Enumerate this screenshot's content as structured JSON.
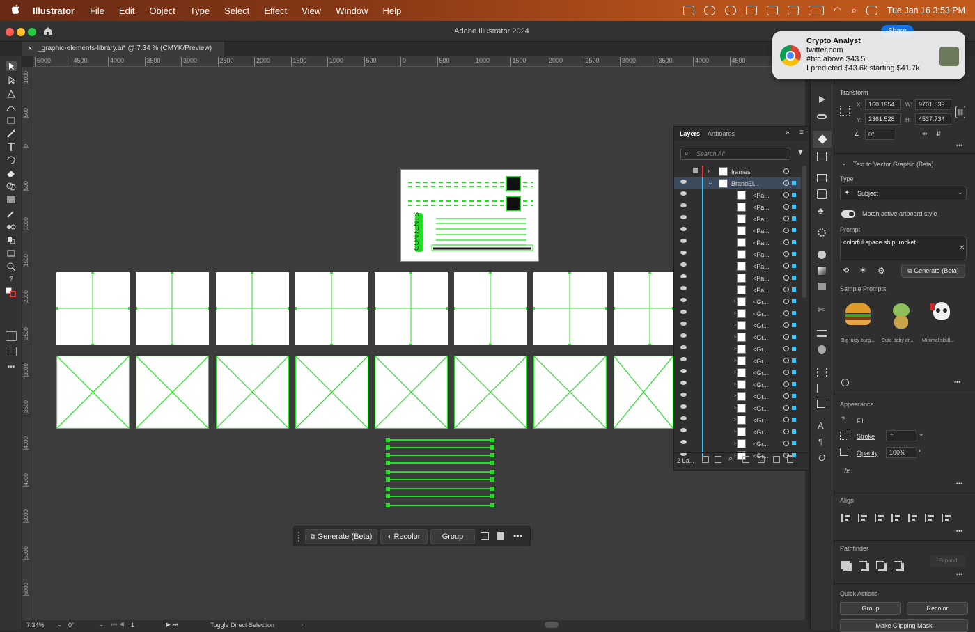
{
  "menubar": {
    "app_name": "Illustrator",
    "items": [
      "File",
      "Edit",
      "Object",
      "Type",
      "Select",
      "Effect",
      "View",
      "Window",
      "Help"
    ],
    "clock": "Tue Jan 16  3:53 PM"
  },
  "window": {
    "title": "Adobe Illustrator 2024",
    "share_label": "Share"
  },
  "document_tab": {
    "close": "×",
    "label": "_graphic-elements-library.ai* @ 7.34 % (CMYK/Preview)"
  },
  "ruler": {
    "h_ticks": [
      "5000",
      "4500",
      "4000",
      "3500",
      "3000",
      "2500",
      "2000",
      "1500",
      "1000",
      "500",
      "0",
      "500",
      "1000",
      "1500",
      "2000",
      "2500",
      "3000",
      "3500",
      "4000",
      "4500"
    ],
    "v_ticks": [
      "1000",
      "500",
      "0",
      "500",
      "1000",
      "1500",
      "2000",
      "2500",
      "3000",
      "3500",
      "4000",
      "4500",
      "5000",
      "5500",
      "6000"
    ]
  },
  "artboard": {
    "vertical_label": "CONTENTS"
  },
  "context_bar": {
    "generate": "Generate (Beta)",
    "recolor": "Recolor",
    "group": "Group",
    "more": "•••"
  },
  "statusbar": {
    "zoom": "7.34%",
    "angle": "0°",
    "artboard_num": "1",
    "tool_hint": "Toggle Direct Selection"
  },
  "layers": {
    "tab_layers": "Layers",
    "tab_artboards": "Artboards",
    "search_placeholder": "Search All",
    "footer_count": "2 La...",
    "rows": [
      {
        "name": "frames",
        "vis": false,
        "lock": true,
        "expanded": false,
        "indent": 0
      },
      {
        "name": "BrandEl...",
        "vis": true,
        "lock": false,
        "expanded": true,
        "indent": 0,
        "selected": true
      },
      {
        "name": "<Pa...",
        "vis": true,
        "indent": 1
      },
      {
        "name": "<Pa...",
        "vis": true,
        "indent": 1
      },
      {
        "name": "<Pa...",
        "vis": true,
        "indent": 1
      },
      {
        "name": "<Pa...",
        "vis": true,
        "indent": 1
      },
      {
        "name": "<Pa...",
        "vis": true,
        "indent": 1
      },
      {
        "name": "<Pa...",
        "vis": true,
        "indent": 1
      },
      {
        "name": "<Pa...",
        "vis": true,
        "indent": 1
      },
      {
        "name": "<Pa...",
        "vis": true,
        "indent": 1
      },
      {
        "name": "<Pa...",
        "vis": true,
        "indent": 1
      },
      {
        "name": "<Gr...",
        "vis": true,
        "indent": 1,
        "group": true
      },
      {
        "name": "<Gr...",
        "vis": true,
        "indent": 1,
        "group": true
      },
      {
        "name": "<Gr...",
        "vis": true,
        "indent": 1,
        "group": true
      },
      {
        "name": "<Gr...",
        "vis": true,
        "indent": 1,
        "group": true
      },
      {
        "name": "<Gr...",
        "vis": true,
        "indent": 1,
        "group": true
      },
      {
        "name": "<Gr...",
        "vis": true,
        "indent": 1,
        "group": true
      },
      {
        "name": "<Gr...",
        "vis": true,
        "indent": 1,
        "group": true
      },
      {
        "name": "<Gr...",
        "vis": true,
        "indent": 1,
        "group": true
      },
      {
        "name": "<Gr...",
        "vis": true,
        "indent": 1,
        "group": true
      },
      {
        "name": "<Gr...",
        "vis": true,
        "indent": 1,
        "group": true
      },
      {
        "name": "<Gr...",
        "vis": true,
        "indent": 1,
        "group": true
      },
      {
        "name": "<Gr...",
        "vis": true,
        "indent": 1,
        "group": true
      },
      {
        "name": "<Gr...",
        "vis": true,
        "indent": 1,
        "group": true
      },
      {
        "name": "<Gr...",
        "vis": true,
        "indent": 1,
        "group": true
      }
    ]
  },
  "properties": {
    "transform": {
      "title": "Transform",
      "x_label": "X:",
      "x": "160.1954",
      "y_label": "Y:",
      "y": "2361.528",
      "w_label": "W:",
      "w": "9701.539",
      "h_label": "H:",
      "h": "4537.734",
      "angle": "0°"
    },
    "t2v": {
      "title": "Text to Vector Graphic (Beta)",
      "type_label": "Type",
      "type_value": "Subject",
      "match_style": "Match active artboard style",
      "prompt_label": "Prompt",
      "prompt_value": "colorful space ship, rocket",
      "generate": "Generate (Beta)",
      "sample_title": "Sample Prompts",
      "samples": [
        "Big juicy burg...",
        "Cute baby dr...",
        "Minimal skull..."
      ]
    },
    "appearance": {
      "title": "Appearance",
      "fill": "Fill",
      "stroke": "Stroke",
      "opacity_label": "Opacity",
      "opacity": "100%",
      "fx": "fx."
    },
    "align": {
      "title": "Align"
    },
    "pathfinder": {
      "title": "Pathfinder",
      "expand": "Expand"
    },
    "quick_actions": {
      "title": "Quick Actions",
      "group": "Group",
      "recolor": "Recolor",
      "clipping": "Make Clipping Mask"
    }
  },
  "notification": {
    "title": "Crypto Analyst",
    "source": "twitter.com",
    "line1": "#btc above $43.5.",
    "line2": "I predicted $43.6k starting $41.7k"
  },
  "colors": {
    "accent_green": "#22e022",
    "selection_blue": "#1473e6",
    "layer_color": "#35c8ff"
  }
}
